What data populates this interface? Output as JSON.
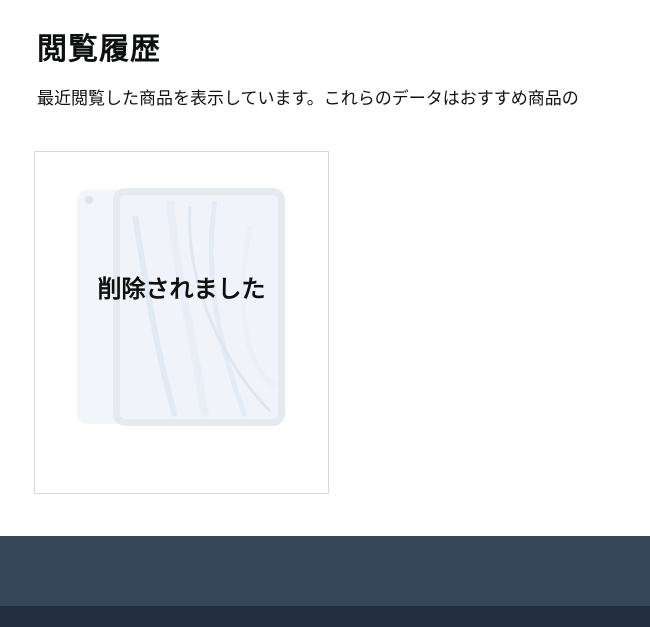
{
  "history": {
    "title": "閲覧履歴",
    "description": "最近閲覧した商品を表示しています。これらのデータはおすすめ商品の"
  },
  "items": [
    {
      "status_label": "削除されました",
      "image_icon": "tablet-icon"
    }
  ],
  "colors": {
    "footer_primary": "#37475a",
    "footer_secondary": "#232f3e",
    "card_border": "#d5d9d9"
  }
}
